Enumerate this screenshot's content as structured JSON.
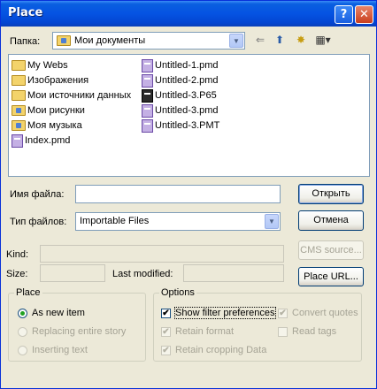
{
  "window": {
    "title": "Place",
    "help": "?",
    "close": "✕"
  },
  "lookin": {
    "label": "Папка:",
    "value": "Мои документы",
    "arrow": "▼"
  },
  "toolbar": {
    "back": "⇐",
    "up": "⬆",
    "newfolder": "✸",
    "view": "▦▾"
  },
  "files": [
    {
      "name": "My Webs",
      "type": "folder"
    },
    {
      "name": "Изображения",
      "type": "folder"
    },
    {
      "name": "Мои источники данных",
      "type": "folder"
    },
    {
      "name": "Мои рисунки",
      "type": "folder"
    },
    {
      "name": "Моя музыка",
      "type": "folder"
    },
    {
      "name": "Index.pmd",
      "type": "doc"
    },
    {
      "name": "Untitled-1.pmd",
      "type": "doc"
    },
    {
      "name": "Untitled-2.pmd",
      "type": "doc"
    },
    {
      "name": "Untitled-3.P65",
      "type": "p65"
    },
    {
      "name": "Untitled-3.pmd",
      "type": "doc"
    },
    {
      "name": "Untitled-3.PMT",
      "type": "doc"
    }
  ],
  "filename": {
    "label": "Имя файла:",
    "value": ""
  },
  "filetype": {
    "label": "Тип файлов:",
    "value": "Importable Files",
    "arrow": "▼"
  },
  "buttons": {
    "open": "Открыть",
    "cancel": "Отмена",
    "cms": "CMS source...",
    "placeurl": "Place URL..."
  },
  "kind": {
    "label": "Kind:"
  },
  "size": {
    "label": "Size:"
  },
  "lastmod": {
    "label": "Last modified:"
  },
  "place": {
    "title": "Place",
    "new_item": "As new item",
    "replacing": "Replacing entire story",
    "inserting": "Inserting text"
  },
  "options": {
    "title": "Options",
    "show_filter": "Show filter preferences",
    "convert_quotes": "Convert quotes",
    "retain_format": "Retain format",
    "read_tags": "Read tags",
    "retain_cropping": "Retain cropping Data",
    "check_mark": "✔"
  }
}
